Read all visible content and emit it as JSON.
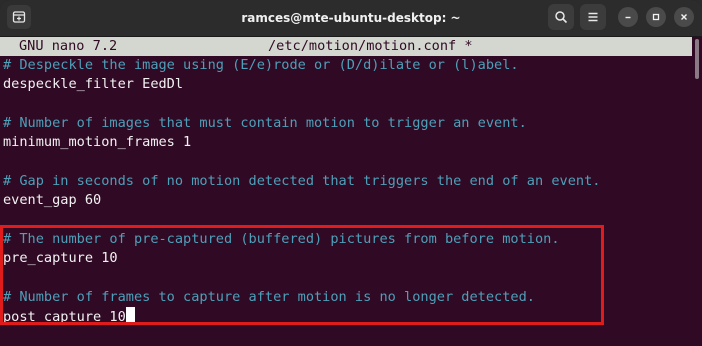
{
  "window": {
    "title": "ramces@mte-ubuntu-desktop: ~",
    "icons": {
      "new_tab": "new-tab-icon",
      "search": "search-icon",
      "menu": "hamburger-menu-icon",
      "minimize": "minimize-icon",
      "maximize": "maximize-icon",
      "close": "close-icon"
    }
  },
  "nano": {
    "version_label": "GNU nano 7.2",
    "filename_label": "/etc/motion/motion.conf *"
  },
  "lines": [
    {
      "kind": "comment",
      "text": "# Despeckle the image using (E/e)rode or (D/d)ilate or (l)abel."
    },
    {
      "kind": "setting",
      "text": "despeckle_filter EedDl"
    },
    {
      "kind": "blank",
      "text": ""
    },
    {
      "kind": "comment",
      "text": "# Number of images that must contain motion to trigger an event."
    },
    {
      "kind": "setting",
      "text": "minimum_motion_frames 1"
    },
    {
      "kind": "blank",
      "text": ""
    },
    {
      "kind": "comment",
      "text": "# Gap in seconds of no motion detected that triggers the end of an event."
    },
    {
      "kind": "setting",
      "text": "event_gap 60"
    },
    {
      "kind": "blank",
      "text": ""
    },
    {
      "kind": "comment",
      "text": "# The number of pre-captured (buffered) pictures from before motion."
    },
    {
      "kind": "setting",
      "text": "pre_capture 10"
    },
    {
      "kind": "blank",
      "text": ""
    },
    {
      "kind": "comment",
      "text": "# Number of frames to capture after motion is no longer detected."
    },
    {
      "kind": "setting",
      "text": "post_capture 10"
    }
  ],
  "colors": {
    "terminal_bg": "#300a24",
    "comment": "#4e9fb8",
    "highlight_border": "#e01b1b"
  }
}
